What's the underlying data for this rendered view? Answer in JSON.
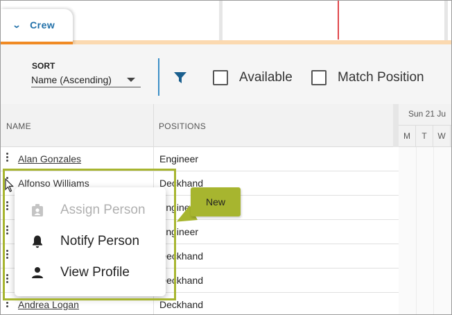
{
  "tabs": {
    "active_label": "Crew",
    "chevron_glyph": "⌄"
  },
  "toolbar": {
    "sort_label": "SORT",
    "sort_value": "Name (Ascending)",
    "filter_icon": "filter-icon",
    "available_label": "Available",
    "match_position_label": "Match Position"
  },
  "grid": {
    "name_header": "NAME",
    "positions_header": "POSITIONS",
    "date_label": "Sun 21 Ju",
    "days": [
      "M",
      "T",
      "W"
    ],
    "rows": [
      {
        "name": "Alan Gonzales",
        "position": "Engineer"
      },
      {
        "name": "Alfonso Williams",
        "position": "Deckhand"
      },
      {
        "name": "",
        "position": "Engineer"
      },
      {
        "name": "",
        "position": "Engineer"
      },
      {
        "name": "",
        "position": "Deckhand"
      },
      {
        "name": "",
        "position": "Deckhand"
      },
      {
        "name": "Andrea Logan",
        "position": "Deckhand"
      }
    ]
  },
  "context_menu": {
    "items": [
      {
        "label": "Assign Person",
        "icon": "badge-icon",
        "disabled": true
      },
      {
        "label": "Notify Person",
        "icon": "bell-icon",
        "disabled": false
      },
      {
        "label": "View Profile",
        "icon": "person-icon",
        "disabled": false
      }
    ]
  },
  "callout": {
    "text": "New"
  },
  "colors": {
    "accent_blue": "#1f6fa8",
    "tab_orange": "#f08a24",
    "highlight_green": "#a7b52f",
    "today_red": "#e0454a"
  }
}
